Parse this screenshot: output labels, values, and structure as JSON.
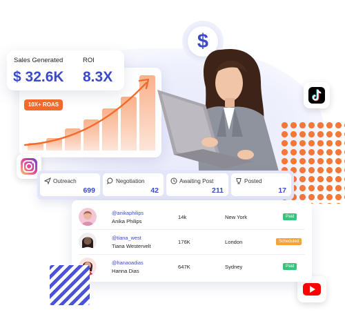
{
  "colors": {
    "accent": "#3b4bc5",
    "orange": "#f36a2a",
    "paid": "#34c47c",
    "scheduled": "#f4a33b",
    "instagram_gradient": [
      "#fdc468",
      "#df4996",
      "#6c3fd1"
    ],
    "tiktok": "#000000",
    "youtube": "#ff0000"
  },
  "metrics": {
    "sales_label": "Sales Generated",
    "sales_value": "$ 32.6K",
    "roi_label": "ROI",
    "roi_value": "8.3X",
    "roas_badge": "10X+ ROAS"
  },
  "growth_chart": {
    "bar_levels": [
      0.09,
      0.15,
      0.27,
      0.38,
      0.52,
      0.66,
      0.92
    ],
    "trend_direction": "up"
  },
  "icons": {
    "dollar": "dollar-sign-icon",
    "instagram": "instagram-icon",
    "tiktok": "tiktok-icon",
    "youtube": "youtube-icon"
  },
  "dollar_symbol": "$",
  "pipeline": [
    {
      "label": "Outreach",
      "count": "699",
      "icon": "send-icon"
    },
    {
      "label": "Negotiation",
      "count": "42",
      "icon": "chat-bubble-icon"
    },
    {
      "label": "Awaiting Post",
      "count": "211",
      "icon": "clock-icon"
    },
    {
      "label": "Posted",
      "count": "17",
      "icon": "trophy-icon"
    }
  ],
  "influencers": [
    {
      "handle": "@anikaphilips",
      "name": "Anika Philips",
      "followers": "14k",
      "city": "New York",
      "status": "Paid",
      "avatar_color": "#d98fb0"
    },
    {
      "handle": "@tiana_west",
      "name": "Tiana Westervelt",
      "followers": "176K",
      "city": "London",
      "status": "Scheduled",
      "avatar_color": "#7a5a4a"
    },
    {
      "handle": "@hanaoadias",
      "name": "Hanna Dias",
      "followers": "647K",
      "city": "Sydney",
      "status": "Paid",
      "avatar_color": "#d63a3a"
    }
  ]
}
